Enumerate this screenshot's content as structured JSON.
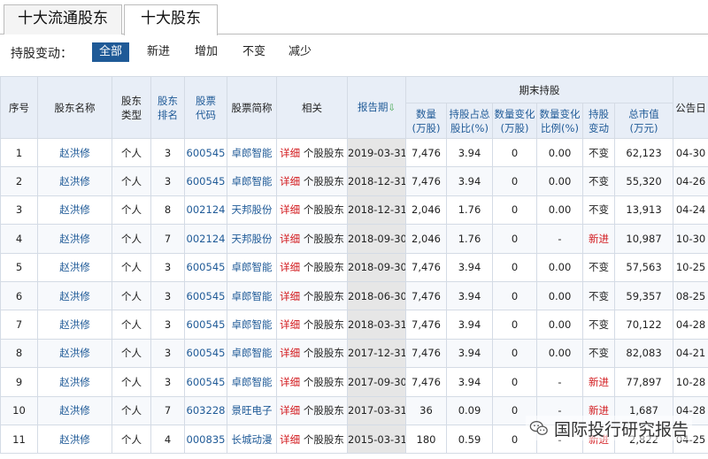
{
  "tabs": [
    {
      "label": "十大流通股东",
      "active": false
    },
    {
      "label": "十大股东",
      "active": true
    }
  ],
  "filters": {
    "label": "持股变动：",
    "options": [
      {
        "label": "全部",
        "active": true
      },
      {
        "label": "新进",
        "active": false
      },
      {
        "label": "增加",
        "active": false
      },
      {
        "label": "不变",
        "active": false
      },
      {
        "label": "减少",
        "active": false
      }
    ]
  },
  "table": {
    "headers": {
      "seq": "序号",
      "name": "股东名称",
      "type": [
        "股东",
        "类型"
      ],
      "rank": [
        "股东",
        "排名"
      ],
      "code": [
        "股票",
        "代码"
      ],
      "stock": "股票简称",
      "related": "相关",
      "report_date": "报告期",
      "report_date_arrow": "⇩",
      "group": "期末持股",
      "qty": [
        "数量",
        "(万股)"
      ],
      "pct": [
        "持股占总",
        "股比(%)"
      ],
      "qty_change": [
        "数量变化",
        "(万股)"
      ],
      "pct_change": [
        "数量变化",
        "比例(%)"
      ],
      "change": [
        "持股",
        "变动"
      ],
      "mkt_value": [
        "总市值",
        "(万元)"
      ],
      "announce": "公告日"
    },
    "rows": [
      {
        "seq": "1",
        "name": "赵洪修",
        "type": "个人",
        "rank": "3",
        "code": "600545",
        "stock": "卓郎智能",
        "detail": "详细",
        "related": "个股股东",
        "date": "2019-03-31",
        "qty": "7,476",
        "pct": "3.94",
        "qty_change": "0",
        "pct_change": "0.00",
        "change": "不变",
        "change_red": false,
        "mkt": "62,123",
        "ann": "04-30"
      },
      {
        "seq": "2",
        "name": "赵洪修",
        "type": "个人",
        "rank": "3",
        "code": "600545",
        "stock": "卓郎智能",
        "detail": "详细",
        "related": "个股股东",
        "date": "2018-12-31",
        "qty": "7,476",
        "pct": "3.94",
        "qty_change": "0",
        "pct_change": "0.00",
        "change": "不变",
        "change_red": false,
        "mkt": "55,320",
        "ann": "04-26"
      },
      {
        "seq": "3",
        "name": "赵洪修",
        "type": "个人",
        "rank": "8",
        "code": "002124",
        "stock": "天邦股份",
        "detail": "详细",
        "related": "个股股东",
        "date": "2018-12-31",
        "qty": "2,046",
        "pct": "1.76",
        "qty_change": "0",
        "pct_change": "0.00",
        "change": "不变",
        "change_red": false,
        "mkt": "13,913",
        "ann": "04-24"
      },
      {
        "seq": "4",
        "name": "赵洪修",
        "type": "个人",
        "rank": "7",
        "code": "002124",
        "stock": "天邦股份",
        "detail": "详细",
        "related": "个股股东",
        "date": "2018-09-30",
        "qty": "2,046",
        "pct": "1.76",
        "qty_change": "0",
        "pct_change": "-",
        "change": "新进",
        "change_red": true,
        "mkt": "10,987",
        "ann": "10-30"
      },
      {
        "seq": "5",
        "name": "赵洪修",
        "type": "个人",
        "rank": "3",
        "code": "600545",
        "stock": "卓郎智能",
        "detail": "详细",
        "related": "个股股东",
        "date": "2018-09-30",
        "qty": "7,476",
        "pct": "3.94",
        "qty_change": "0",
        "pct_change": "0.00",
        "change": "不变",
        "change_red": false,
        "mkt": "57,563",
        "ann": "10-25"
      },
      {
        "seq": "6",
        "name": "赵洪修",
        "type": "个人",
        "rank": "3",
        "code": "600545",
        "stock": "卓郎智能",
        "detail": "详细",
        "related": "个股股东",
        "date": "2018-06-30",
        "qty": "7,476",
        "pct": "3.94",
        "qty_change": "0",
        "pct_change": "0.00",
        "change": "不变",
        "change_red": false,
        "mkt": "59,357",
        "ann": "08-25"
      },
      {
        "seq": "7",
        "name": "赵洪修",
        "type": "个人",
        "rank": "3",
        "code": "600545",
        "stock": "卓郎智能",
        "detail": "详细",
        "related": "个股股东",
        "date": "2018-03-31",
        "qty": "7,476",
        "pct": "3.94",
        "qty_change": "0",
        "pct_change": "0.00",
        "change": "不变",
        "change_red": false,
        "mkt": "70,122",
        "ann": "04-28"
      },
      {
        "seq": "8",
        "name": "赵洪修",
        "type": "个人",
        "rank": "3",
        "code": "600545",
        "stock": "卓郎智能",
        "detail": "详细",
        "related": "个股股东",
        "date": "2017-12-31",
        "qty": "7,476",
        "pct": "3.94",
        "qty_change": "0",
        "pct_change": "0.00",
        "change": "不变",
        "change_red": false,
        "mkt": "82,083",
        "ann": "04-21"
      },
      {
        "seq": "9",
        "name": "赵洪修",
        "type": "个人",
        "rank": "3",
        "code": "600545",
        "stock": "卓郎智能",
        "detail": "详细",
        "related": "个股股东",
        "date": "2017-09-30",
        "qty": "7,476",
        "pct": "3.94",
        "qty_change": "0",
        "pct_change": "-",
        "change": "新进",
        "change_red": true,
        "mkt": "77,897",
        "ann": "10-28"
      },
      {
        "seq": "10",
        "name": "赵洪修",
        "type": "个人",
        "rank": "7",
        "code": "603228",
        "stock": "景旺电子",
        "detail": "详细",
        "related": "个股股东",
        "date": "2017-03-31",
        "qty": "36",
        "pct": "0.09",
        "qty_change": "0",
        "pct_change": "-",
        "change": "新进",
        "change_red": true,
        "mkt": "1,687",
        "ann": "04-28"
      },
      {
        "seq": "11",
        "name": "赵洪修",
        "type": "个人",
        "rank": "4",
        "code": "000835",
        "stock": "长城动漫",
        "detail": "详细",
        "related": "个股股东",
        "date": "2015-03-31",
        "qty": "180",
        "pct": "0.59",
        "qty_change": "0",
        "pct_change": "-",
        "change": "新进",
        "change_red": true,
        "mkt": "2,822",
        "ann": "04-25"
      }
    ]
  },
  "watermark": {
    "text": "国际投行研究报告",
    "icon": "wechat-icon"
  }
}
